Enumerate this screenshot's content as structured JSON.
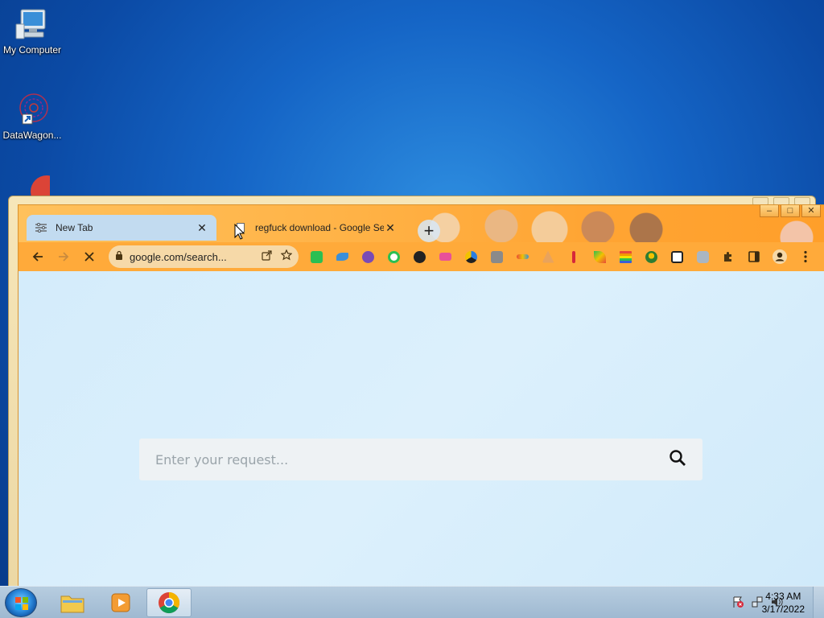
{
  "desktop": {
    "icons": [
      {
        "label": "My Computer",
        "icon": "my-computer-icon"
      },
      {
        "label": "DataWagon...",
        "icon": "datawagon-icon"
      },
      {
        "label": "",
        "icon": "chrome-desktop-icon"
      }
    ]
  },
  "browser": {
    "tabs": [
      {
        "title": "New Tab",
        "icon": "customize-icon",
        "active": true
      },
      {
        "title": "regfuck download - Google Search",
        "icon": "page-icon",
        "active": false
      }
    ],
    "new_tab_label": "+",
    "address": {
      "url": "google.com/search..."
    },
    "extensions": [
      "meet",
      "bird",
      "monster",
      "circle-green",
      "clock-dark",
      "bus",
      "ball",
      "square-o",
      "tag",
      "arrow-up",
      "bar-red",
      "rainbow-leaf",
      "rainbow",
      "globe",
      "puzzle-piece-color",
      "robot",
      "puzzle",
      "sidepanel",
      "profile",
      "menu"
    ]
  },
  "page": {
    "search_placeholder": "Enter your request...",
    "search_value": ""
  },
  "taskbar": {
    "apps": [
      "file-explorer",
      "media-player",
      "chrome"
    ],
    "clock": {
      "time": "4:33 AM",
      "date": "3/17/2022"
    }
  },
  "colors": {
    "theme_orange": "#ffaa3a",
    "tab_active": "#c2dbf0",
    "desktop_blue": "#1565c6"
  }
}
